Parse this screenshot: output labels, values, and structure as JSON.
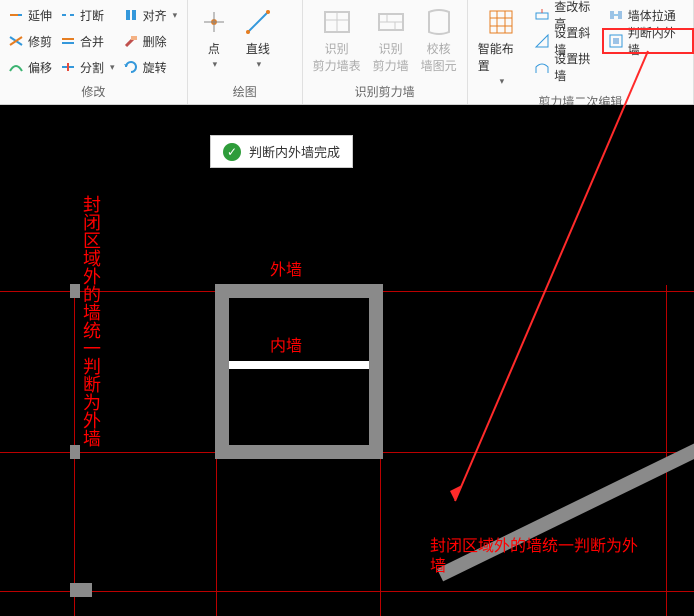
{
  "ribbon": {
    "modify": {
      "title": "修改",
      "extend": "延伸",
      "break": "打断",
      "align": "对齐",
      "trim": "修剪",
      "merge": "合并",
      "delete": "删除",
      "offset": "偏移",
      "split": "分割",
      "rotate": "旋转"
    },
    "draw": {
      "title": "绘图",
      "point": "点",
      "line": "直线"
    },
    "identify": {
      "title": "识别剪力墙",
      "id_table": "识别\n剪力墙表",
      "id_wall": "识别\n剪力墙",
      "check_elem": "校核\n墙图元"
    },
    "edit": {
      "title": "剪力墙二次编辑",
      "smart": "智能布置",
      "chk_elev": "查改标高",
      "set_oblique": "设置斜墙",
      "set_arch": "设置拱墙",
      "extend_wall": "墙体拉通",
      "judge": "判断内外墙"
    }
  },
  "toast": {
    "msg": "判断内外墙完成"
  },
  "labels": {
    "outer": "外墙",
    "inner": "内墙",
    "note_v": "封闭区域外的墙统一判断为外墙",
    "note_h": "封闭区域外的墙统一判断为外墙"
  }
}
